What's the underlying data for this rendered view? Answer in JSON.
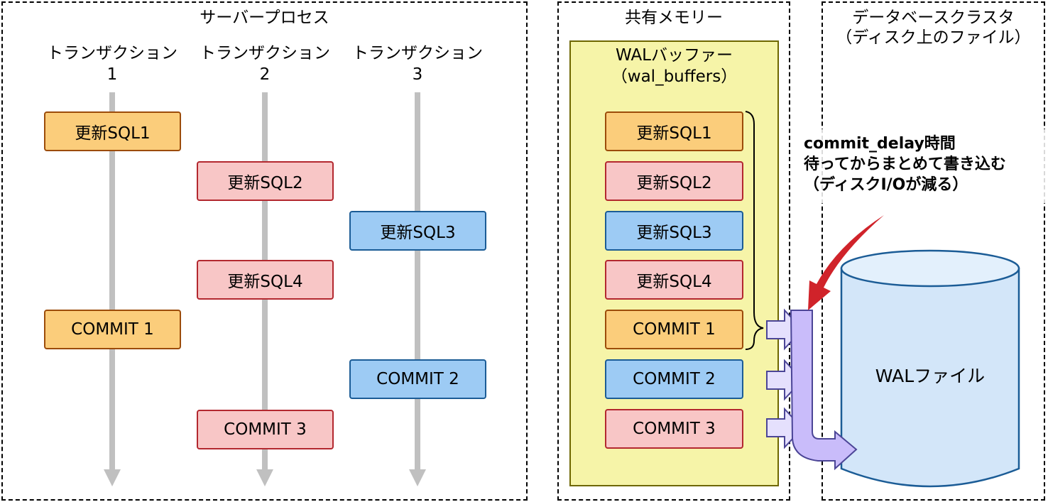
{
  "panels": {
    "server_process": {
      "title": "サーバープロセス"
    },
    "shared_memory": {
      "title": "共有メモリー"
    },
    "database_cluster": {
      "title": "データベースクラスタ",
      "subtitle": "（ディスク上のファイル）"
    }
  },
  "transactions": [
    {
      "label": "トランザクション",
      "number": "1"
    },
    {
      "label": "トランザクション",
      "number": "2"
    },
    {
      "label": "トランザクション",
      "number": "3"
    }
  ],
  "timeline_events": [
    {
      "lane": 1,
      "label": "更新SQL1",
      "color": "orange"
    },
    {
      "lane": 2,
      "label": "更新SQL2",
      "color": "pink"
    },
    {
      "lane": 3,
      "label": "更新SQL3",
      "color": "blue"
    },
    {
      "lane": 2,
      "label": "更新SQL4",
      "color": "pink"
    },
    {
      "lane": 1,
      "label": "COMMIT 1",
      "color": "orange"
    },
    {
      "lane": 3,
      "label": "COMMIT 2",
      "color": "blue"
    },
    {
      "lane": 2,
      "label": "COMMIT 3",
      "color": "pink"
    }
  ],
  "wal_buffer": {
    "title": "WALバッファー",
    "subtitle": "（wal_buffers）",
    "entries": [
      {
        "label": "更新SQL1",
        "color": "orange"
      },
      {
        "label": "更新SQL2",
        "color": "pink"
      },
      {
        "label": "更新SQL3",
        "color": "blue"
      },
      {
        "label": "更新SQL4",
        "color": "pink"
      },
      {
        "label": "COMMIT 1",
        "color": "orange"
      },
      {
        "label": "COMMIT 2",
        "color": "blue"
      },
      {
        "label": "COMMIT 3",
        "color": "pink"
      }
    ]
  },
  "annotation": {
    "lines": [
      "commit_delay時間",
      "待ってからまとめて書き込む",
      "（ディスクI/Oが減る）"
    ],
    "arrow_color": "#d0232a"
  },
  "wal_file": {
    "label": "WALファイル"
  },
  "colors": {
    "orange_fill": "#fbcd7b",
    "pink_fill": "#f8c6c6",
    "blue_fill": "#9dcbf4",
    "buffer_fill": "#f6f4a8",
    "flow_arrow_fill": "#c9bcfa",
    "flow_arrow_border": "#4b4596",
    "cylinder_fill": "#d3e6f9",
    "cylinder_border": "#1b5c96"
  }
}
